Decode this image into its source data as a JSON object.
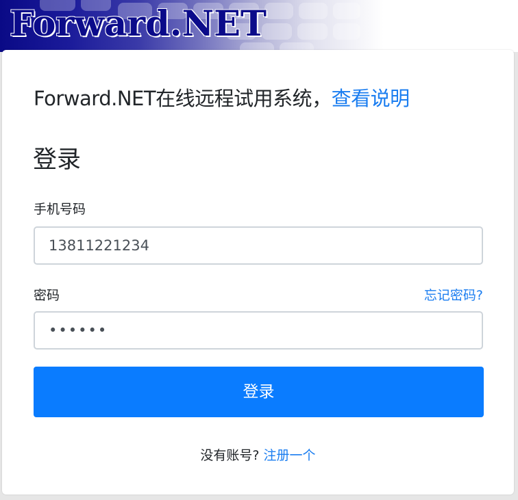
{
  "banner": {
    "logo_text": "Forward.NET"
  },
  "headline": {
    "text": "Forward.NET在线远程试用系统，",
    "link": "查看说明"
  },
  "form": {
    "title": "登录",
    "phone_label": "手机号码",
    "phone_value": "13811221234",
    "password_label": "密码",
    "password_value": "••••••",
    "forgot_link": "忘记密码?",
    "submit_label": "登录"
  },
  "footer": {
    "text": "没有账号? ",
    "register_link": "注册一个"
  },
  "colors": {
    "accent": "#0a7cff",
    "link": "#1a7df0",
    "banner_blue": "#0b0b8a"
  }
}
